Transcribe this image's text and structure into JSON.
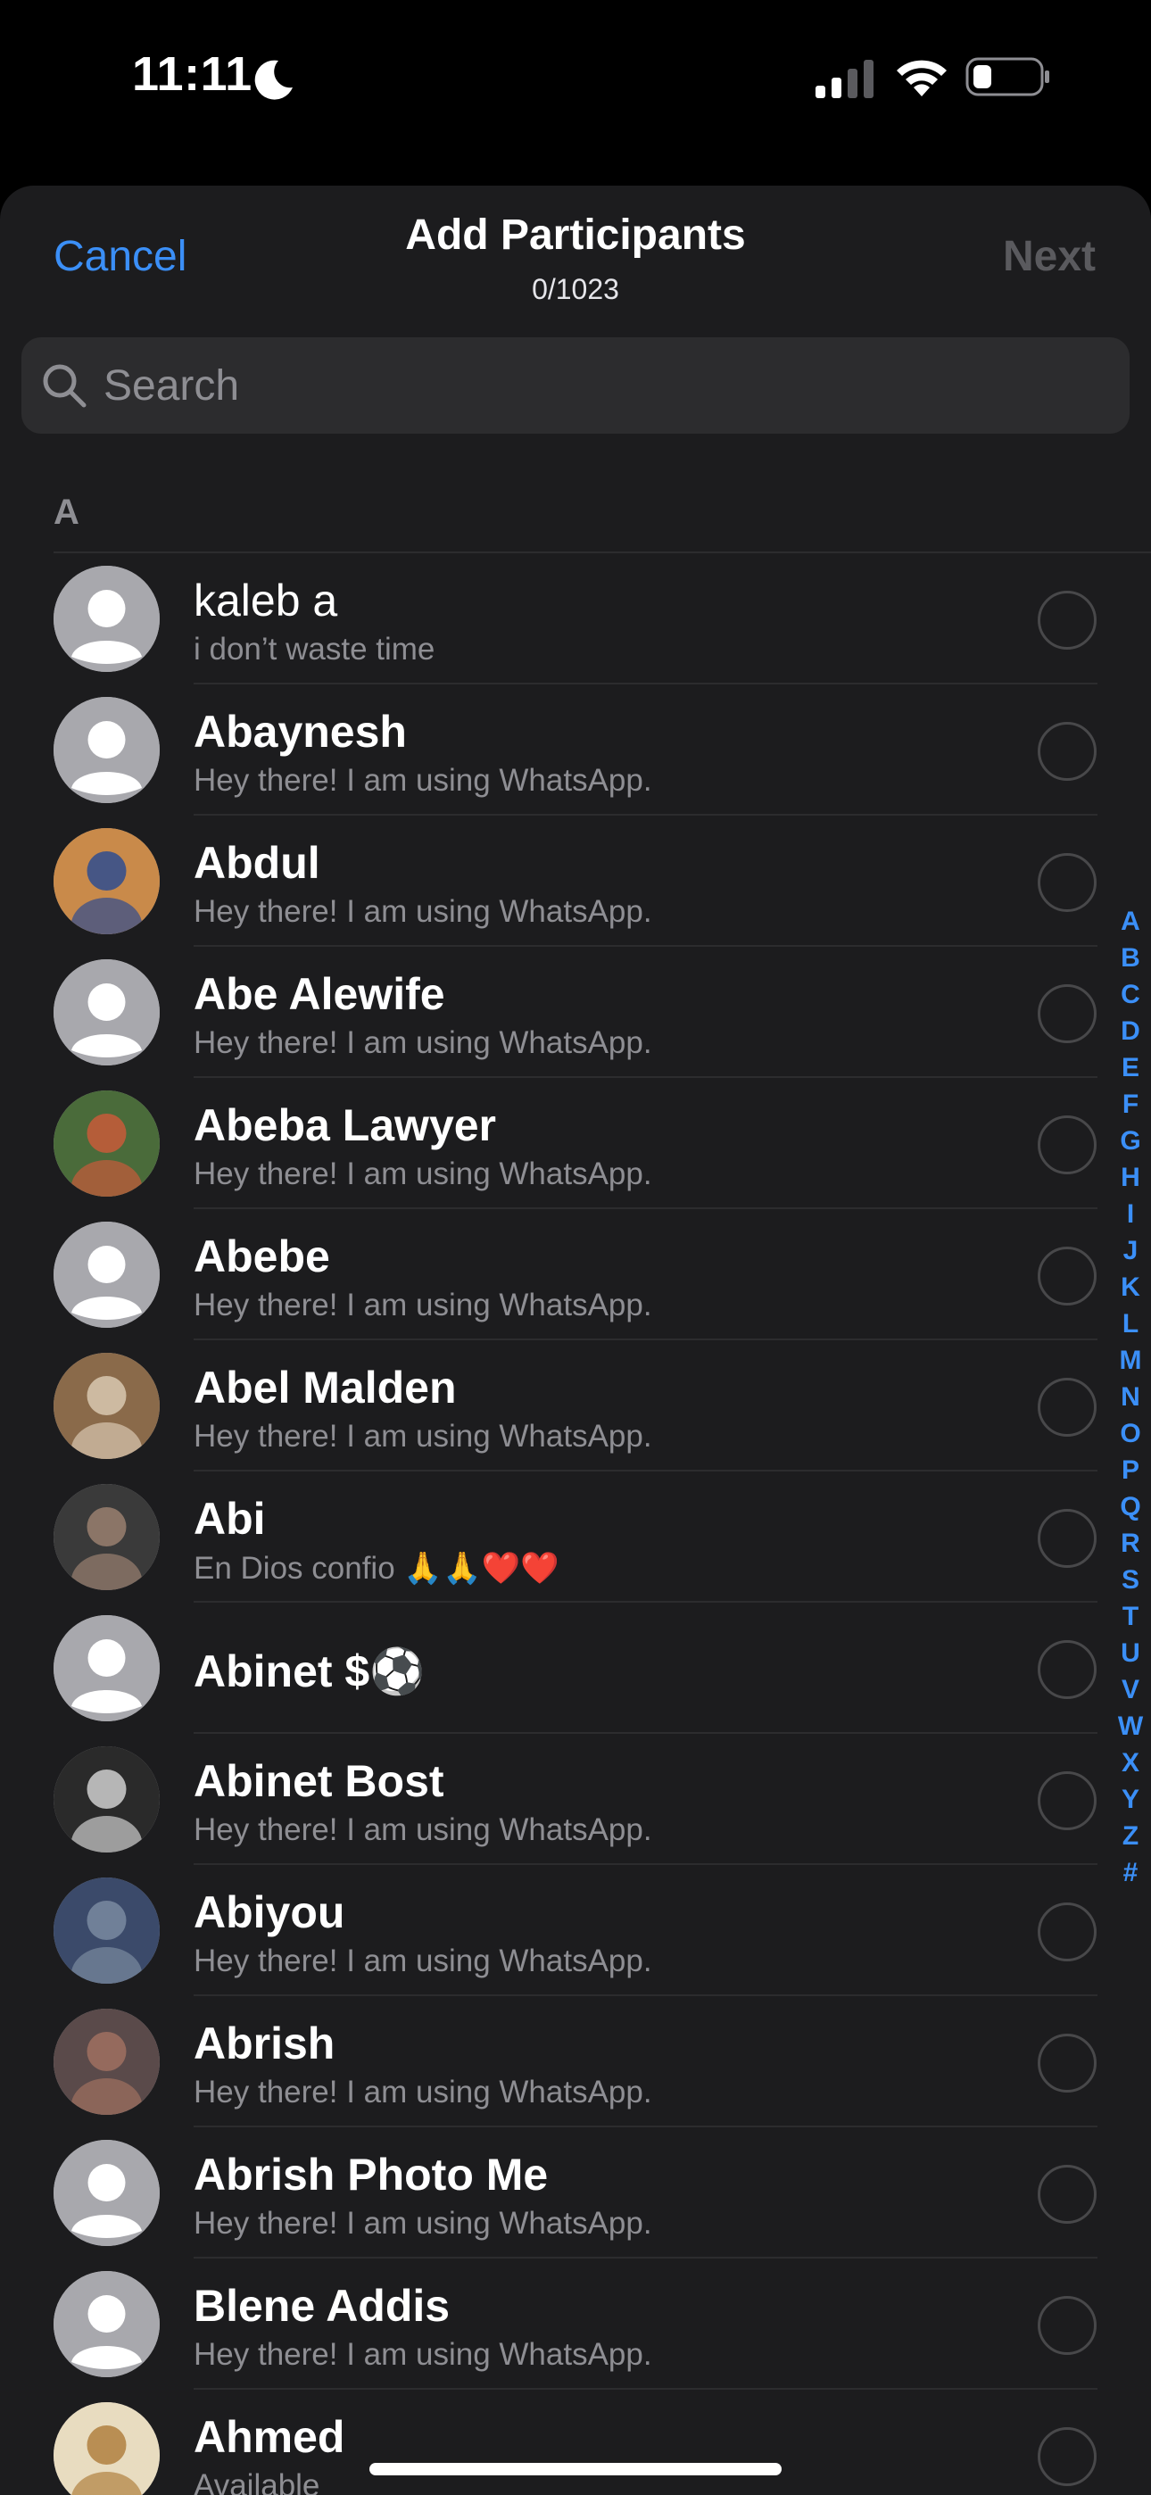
{
  "status_bar": {
    "time": "11:11",
    "icons": [
      "moon-icon",
      "signal-icon",
      "wifi-icon",
      "battery-icon"
    ]
  },
  "nav": {
    "cancel_label": "Cancel",
    "title": "Add Participants",
    "subtitle": "0/1023",
    "next_label": "Next"
  },
  "search": {
    "placeholder": "Search"
  },
  "section": "A",
  "colors": {
    "accent": "#3b8ff7",
    "sheet_bg": "#1c1c1e",
    "secondary_text": "#8e8e93"
  },
  "contacts": [
    {
      "name": "kaleb a",
      "status": "i don’t waste time",
      "avatar": "default"
    },
    {
      "name": "Abaynesh",
      "status": "Hey there! I am using WhatsApp.",
      "avatar": "default"
    },
    {
      "name": "Abdul",
      "status": "Hey there! I am using WhatsApp.",
      "avatar": "photo"
    },
    {
      "name": "Abe Alewife",
      "status": "Hey there! I am using WhatsApp.",
      "avatar": "default"
    },
    {
      "name": "Abeba Lawyer",
      "status": "Hey there! I am using WhatsApp.",
      "avatar": "photo"
    },
    {
      "name": "Abebe",
      "status": "Hey there! I am using WhatsApp.",
      "avatar": "default"
    },
    {
      "name": "Abel Malden",
      "status": "Hey there! I am using WhatsApp.",
      "avatar": "photo"
    },
    {
      "name": "Abi",
      "status": "En Dios confio 🙏🙏❤️❤️",
      "avatar": "photo"
    },
    {
      "name": "Abinet $⚽",
      "status": "",
      "avatar": "default"
    },
    {
      "name": "Abinet Bost",
      "status": "Hey there! I am using WhatsApp.",
      "avatar": "photo"
    },
    {
      "name": "Abiyou",
      "status": "Hey there! I am using WhatsApp.",
      "avatar": "photo"
    },
    {
      "name": "Abrish",
      "status": "Hey there! I am using WhatsApp.",
      "avatar": "photo"
    },
    {
      "name": "Abrish Photo Me",
      "status": "Hey there! I am using WhatsApp.",
      "avatar": "default"
    },
    {
      "name": "Blene Addis",
      "status": "Hey there! I am using WhatsApp.",
      "avatar": "default"
    },
    {
      "name": "Ahmed",
      "status": "Available",
      "avatar": "photo"
    }
  ],
  "index_letters": [
    "A",
    "B",
    "C",
    "D",
    "E",
    "F",
    "G",
    "H",
    "I",
    "J",
    "K",
    "L",
    "M",
    "N",
    "O",
    "P",
    "Q",
    "R",
    "S",
    "T",
    "U",
    "V",
    "W",
    "X",
    "Y",
    "Z",
    "#"
  ]
}
